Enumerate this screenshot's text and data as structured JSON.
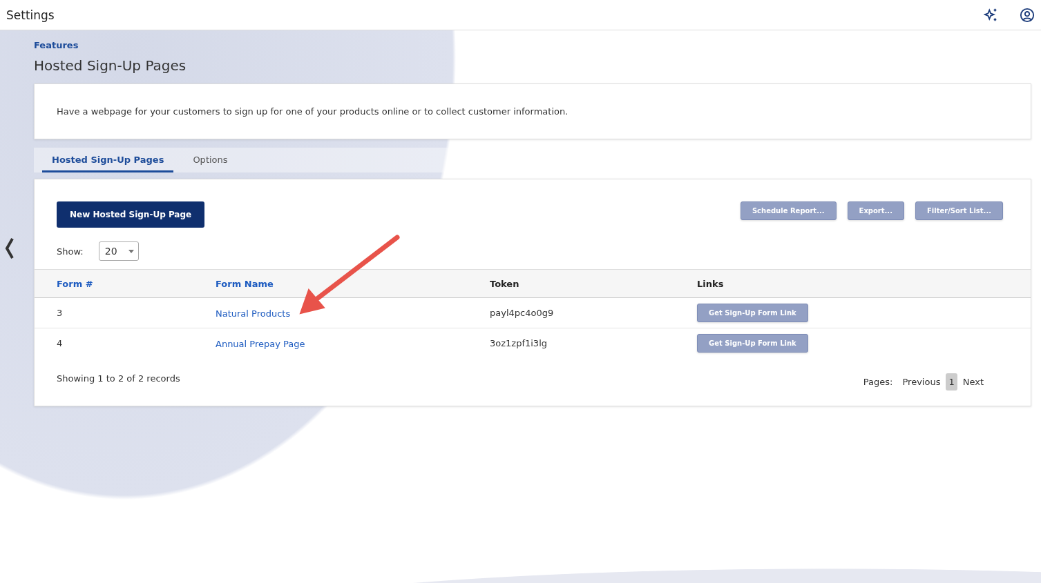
{
  "header": {
    "title": "Settings"
  },
  "breadcrumb": "Features",
  "page_title": "Hosted Sign-Up Pages",
  "description": "Have a webpage for your customers to sign up for one of your products online or to collect customer information.",
  "tabs": [
    {
      "label": "Hosted Sign-Up Pages",
      "selected": true
    },
    {
      "label": "Options",
      "selected": false
    }
  ],
  "new_button": "New Hosted Sign-Up Page",
  "actions": [
    "Schedule Report...",
    "Export...",
    "Filter/Sort List..."
  ],
  "show": {
    "label": "Show:",
    "value": "20"
  },
  "table": {
    "columns": [
      {
        "label": "Form #",
        "sortable": true
      },
      {
        "label": "Form Name",
        "sortable": true
      },
      {
        "label": "Token",
        "sortable": false
      },
      {
        "label": "Links",
        "sortable": false
      }
    ],
    "rows": [
      {
        "form": "3",
        "name": "Natural Products",
        "token": "payl4pc4o0g9",
        "link": "Get Sign-Up Form Link"
      },
      {
        "form": "4",
        "name": "Annual Prepay Page",
        "token": "3oz1zpf1i3lg",
        "link": "Get Sign-Up Form Link"
      }
    ]
  },
  "summary": "Showing 1 to 2 of 2 records",
  "pagination": {
    "label": "Pages:",
    "previous": "Previous",
    "pages": [
      {
        "label": "1",
        "selected": true
      }
    ],
    "next": "Next"
  }
}
